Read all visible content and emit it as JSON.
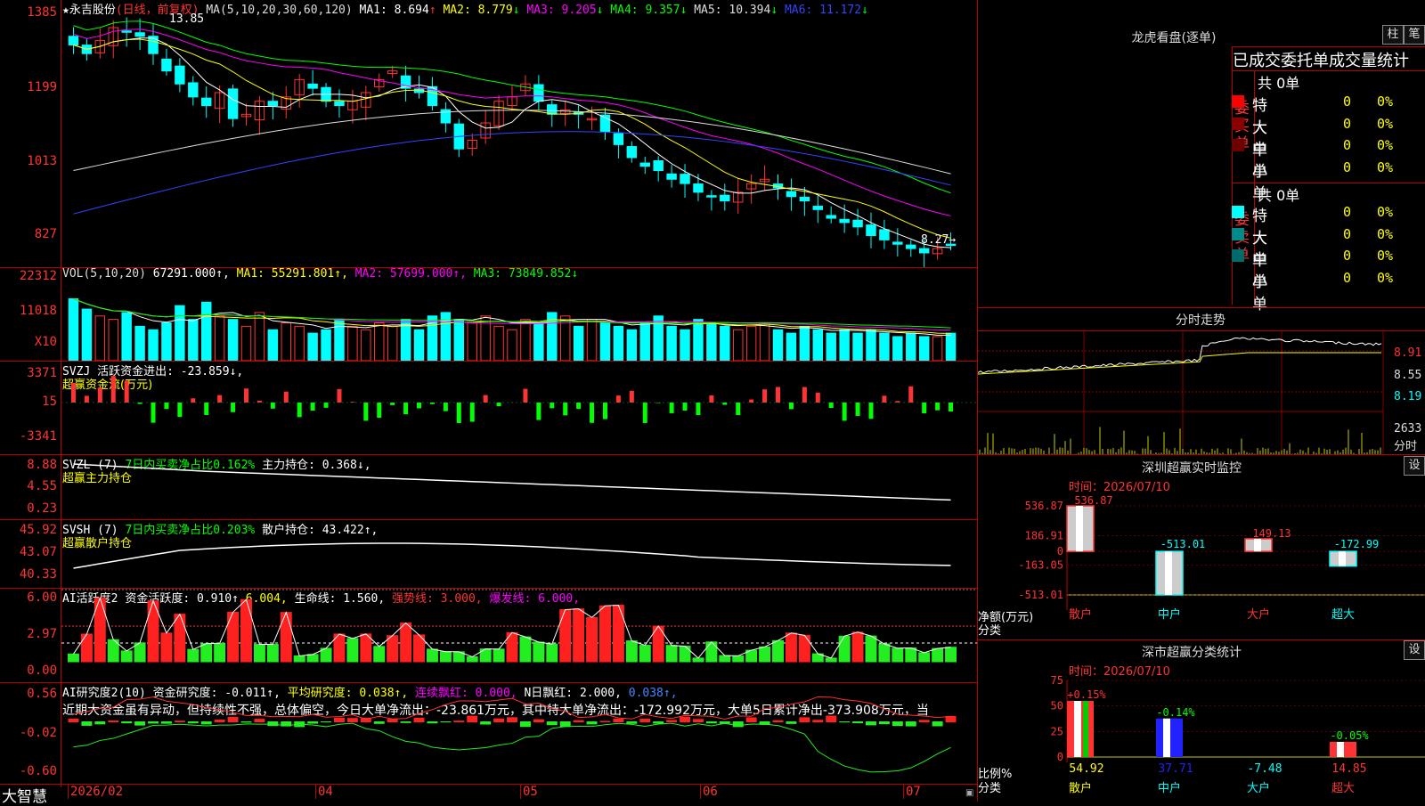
{
  "stock": {
    "name": "永吉股份",
    "cycle": "(日线，前复权)",
    "ma_def": "MA(5,10,20,30,60,120)"
  },
  "ma_header": [
    {
      "label": "MA1: 8.694",
      "arrow": "↑",
      "color": "#ffffff"
    },
    {
      "label": "MA2: 8.779",
      "arrow": "↓",
      "color": "#ffff00"
    },
    {
      "label": "MA3: 9.205",
      "arrow": "↓",
      "color": "#ff00ff"
    },
    {
      "label": "MA4: 9.357",
      "arrow": "↓",
      "color": "#00ff00"
    },
    {
      "label": "MA5: 10.394",
      "arrow": "↓",
      "color": "#dddddd"
    },
    {
      "label": "MA6: 11.172",
      "arrow": "↓",
      "color": "#3344ff"
    }
  ],
  "price_axis": [
    "1385",
    "1199",
    "1013",
    "827"
  ],
  "price_high_label": "13.85",
  "price_low_label": "8.27→",
  "vol_header": [
    {
      "label": "VOL(5,10,20)",
      "color": "#dddddd"
    },
    {
      "label": "67291.000↑,",
      "color": "#ffffff"
    },
    {
      "label": "MA1: 55291.801↑,",
      "color": "#ffff00"
    },
    {
      "label": "MA2: 57699.000↑,",
      "color": "#ff00ff"
    },
    {
      "label": "MA3: 73849.852↓",
      "color": "#00ff00"
    }
  ],
  "vol_axis": [
    "22312",
    "11018",
    "X10"
  ],
  "svzj": {
    "header": "SVZJ  活跃资金进出: -23.859↓,",
    "sub": "超赢资金流(万元)",
    "axis": [
      "3371",
      "15",
      "-3341"
    ]
  },
  "svzl": {
    "header_a": "SVZL (7)",
    "header_b": "7日内买卖净占比0.162%",
    "header_c": "主力持仓: 0.368↓,",
    "sub": "超赢主力持仓",
    "axis": [
      "8.88",
      "4.55",
      "0.23"
    ]
  },
  "svsh": {
    "header_a": "SVSH (7)",
    "header_b": "7日内买卖净占比0.203%",
    "header_c": "散户持仓: 43.422↑,",
    "sub": "超赢散户持仓",
    "axis": [
      "45.92",
      "43.07",
      "40.33"
    ]
  },
  "ai_active": {
    "header_a": "AI活跃度2",
    "header_b": "资金活跃度: 0.910↑,",
    "header_c": "6.004,",
    "header_d": "生命线: 1.560,",
    "header_e": "强势线: 3.000,",
    "header_f": "爆发线: 6.000,",
    "axis": [
      "6.00",
      "2.97",
      "0.00"
    ]
  },
  "ai_research": {
    "header_a": "AI研究度2(10)",
    "header_b": "资金研究度: -0.011↑,",
    "header_c": "平均研究度: 0.038↑,",
    "header_d": "连续飘红: 0.000,",
    "header_e": "N日飘红: 2.000,",
    "header_f": "0.038↑,",
    "text": "近期大资金虽有异动，但持续性不强，总体偏空，今日大单净流出：-23.861万元，其中特大单净流出：-172.992万元，大单5日累计净出-373.908万元，当",
    "axis": [
      "0.56",
      "-0.02",
      "-0.60"
    ]
  },
  "dates": [
    "2026/02",
    "04",
    "05",
    "06",
    "07"
  ],
  "brand": "大智慧",
  "right": {
    "lhb_title": "龙虎看盘(逐单)",
    "btn_zhu": "柱",
    "btn_bi": "笔",
    "table_title": "已成交委托单成交量统计",
    "buy_label": "委买单",
    "sell_label": "委卖单",
    "buy_total": "共 0单",
    "sell_total": "共 0单",
    "rows": [
      {
        "name": "特大",
        "val": "0",
        "pct": "0%"
      },
      {
        "name": "大单",
        "val": "0",
        "pct": "0%"
      },
      {
        "name": "中单",
        "val": "0",
        "pct": "0%"
      },
      {
        "name": "小单",
        "val": "0",
        "pct": "0%"
      }
    ],
    "rows_sell": [
      {
        "name": "特大",
        "val": "0",
        "pct": "0%"
      },
      {
        "name": "大单",
        "val": "0",
        "pct": "0%"
      },
      {
        "name": "中单",
        "val": "0",
        "pct": "0%"
      },
      {
        "name": "小单",
        "val": "0",
        "pct": "0%"
      }
    ],
    "fs_title": "分时走势",
    "fs_axis": [
      "8.91",
      "8.55",
      "8.19",
      "2633",
      "分时"
    ],
    "sz_title": "深圳超赢实时监控",
    "sz_time": "时间：2026/07/10",
    "sz_btn": "设",
    "sz_axis": [
      "536.87",
      "186.91",
      "0",
      "-163.05",
      "-513.01"
    ],
    "sz_ylabel": "净额(万元)",
    "sz_xlabel": "分类",
    "sz_cats": [
      "散户",
      "中户",
      "大户",
      "超大"
    ],
    "sz_vals": [
      "536.87",
      "-513.01",
      "149.13",
      "-172.99"
    ],
    "ss_title": "深市超赢分类统计",
    "ss_time": "时间：2026/07/10",
    "ss_btn": "设",
    "ss_axis": [
      "75",
      "50",
      "25",
      "0"
    ],
    "ss_ylabel": "比例%",
    "ss_xlabel": "分类",
    "ss_cats": [
      "散户",
      "中户",
      "大户",
      "超大"
    ],
    "ss_top": [
      "+0.15%",
      "-0.14%",
      "",
      "-0.05%"
    ],
    "ss_bottom": [
      "54.92",
      "37.71",
      "-7.48",
      "14.85"
    ]
  },
  "chart_data": [
    {
      "type": "candlestick",
      "title": "永吉股份(日线，前复权)",
      "ylim": [
        8.27,
        13.85
      ],
      "x_labels": [
        "2026/02",
        "04",
        "05",
        "06",
        "07"
      ],
      "series": [
        {
          "name": "MA1",
          "color": "#ffffff",
          "value": 8.694
        },
        {
          "name": "MA2",
          "color": "#ffff00",
          "value": 8.779
        },
        {
          "name": "MA3",
          "color": "#ff00ff",
          "value": 9.205
        },
        {
          "name": "MA4",
          "color": "#00ff00",
          "value": 9.357
        },
        {
          "name": "MA5",
          "color": "#dddddd",
          "value": 10.394
        },
        {
          "name": "MA6",
          "color": "#3344ff",
          "value": 11.172
        }
      ],
      "close_approx": [
        13.2,
        13.0,
        13.3,
        13.6,
        13.5,
        13.4,
        13.0,
        12.6,
        12.3,
        12.0,
        11.8,
        12.1,
        11.5,
        11.6,
        11.9,
        11.8,
        12.0,
        12.4,
        12.2,
        11.9,
        11.8,
        11.9,
        12.1,
        12.4,
        12.6,
        12.2,
        12.1,
        11.8,
        11.4,
        10.8,
        11.0,
        11.4,
        11.9,
        12.0,
        12.3,
        11.9,
        11.6,
        11.7,
        11.6,
        11.5,
        11.2,
        10.9,
        10.6,
        10.4,
        10.3,
        10.1,
        10.0,
        9.8,
        9.7,
        9.6,
        9.8,
        10.0,
        10.1,
        9.9,
        9.7,
        9.6,
        9.4,
        9.2,
        9.1,
        9.0,
        8.8,
        8.7,
        8.6,
        8.5,
        8.4,
        8.5,
        8.6
      ]
    },
    {
      "type": "bar",
      "title": "VOL(5,10,20)",
      "ylim": [
        0,
        22312
      ],
      "values_approx": [
        18,
        15,
        13,
        12,
        14,
        10,
        9,
        11,
        16,
        12,
        17,
        13,
        12,
        10,
        14,
        9,
        11,
        10,
        8,
        9,
        12,
        10,
        9,
        11,
        10,
        12,
        9,
        13,
        14,
        12,
        11,
        13,
        10,
        9,
        12,
        11,
        14,
        13,
        10,
        12,
        11,
        10,
        9,
        11,
        13,
        10,
        9,
        12,
        11,
        10,
        9,
        10,
        11,
        9,
        8,
        10,
        9,
        8,
        9,
        8,
        9,
        8,
        7,
        8,
        7,
        7,
        8
      ]
    },
    {
      "type": "bar",
      "title": "SVZJ 超赢资金流(万元)",
      "ylim": [
        -3341,
        3371
      ],
      "last": -23.859
    },
    {
      "type": "line",
      "title": "SVZL 超赢主力持仓",
      "ylim": [
        0.23,
        8.88
      ],
      "last": 0.368
    },
    {
      "type": "line",
      "title": "SVSH 超赢散户持仓",
      "ylim": [
        40.33,
        45.92
      ],
      "last": 43.422
    },
    {
      "type": "bar",
      "title": "AI活跃度2",
      "ylim": [
        0,
        6
      ],
      "last": 0.91
    },
    {
      "type": "bar",
      "title": "AI研究度2(10)",
      "ylim": [
        -0.6,
        0.56
      ],
      "last": -0.011
    },
    {
      "type": "bar",
      "title": "深圳超赢实时监控",
      "categories": [
        "散户",
        "中户",
        "大户",
        "超大"
      ],
      "values": [
        536.87,
        -513.01,
        149.13,
        -172.99
      ],
      "ylim": [
        -513.01,
        536.87
      ]
    },
    {
      "type": "bar",
      "title": "深市超赢分类统计",
      "categories": [
        "散户",
        "中户",
        "大户",
        "超大"
      ],
      "values": [
        54.92,
        37.71,
        -7.48,
        14.85
      ],
      "ylim": [
        0,
        75
      ]
    }
  ]
}
